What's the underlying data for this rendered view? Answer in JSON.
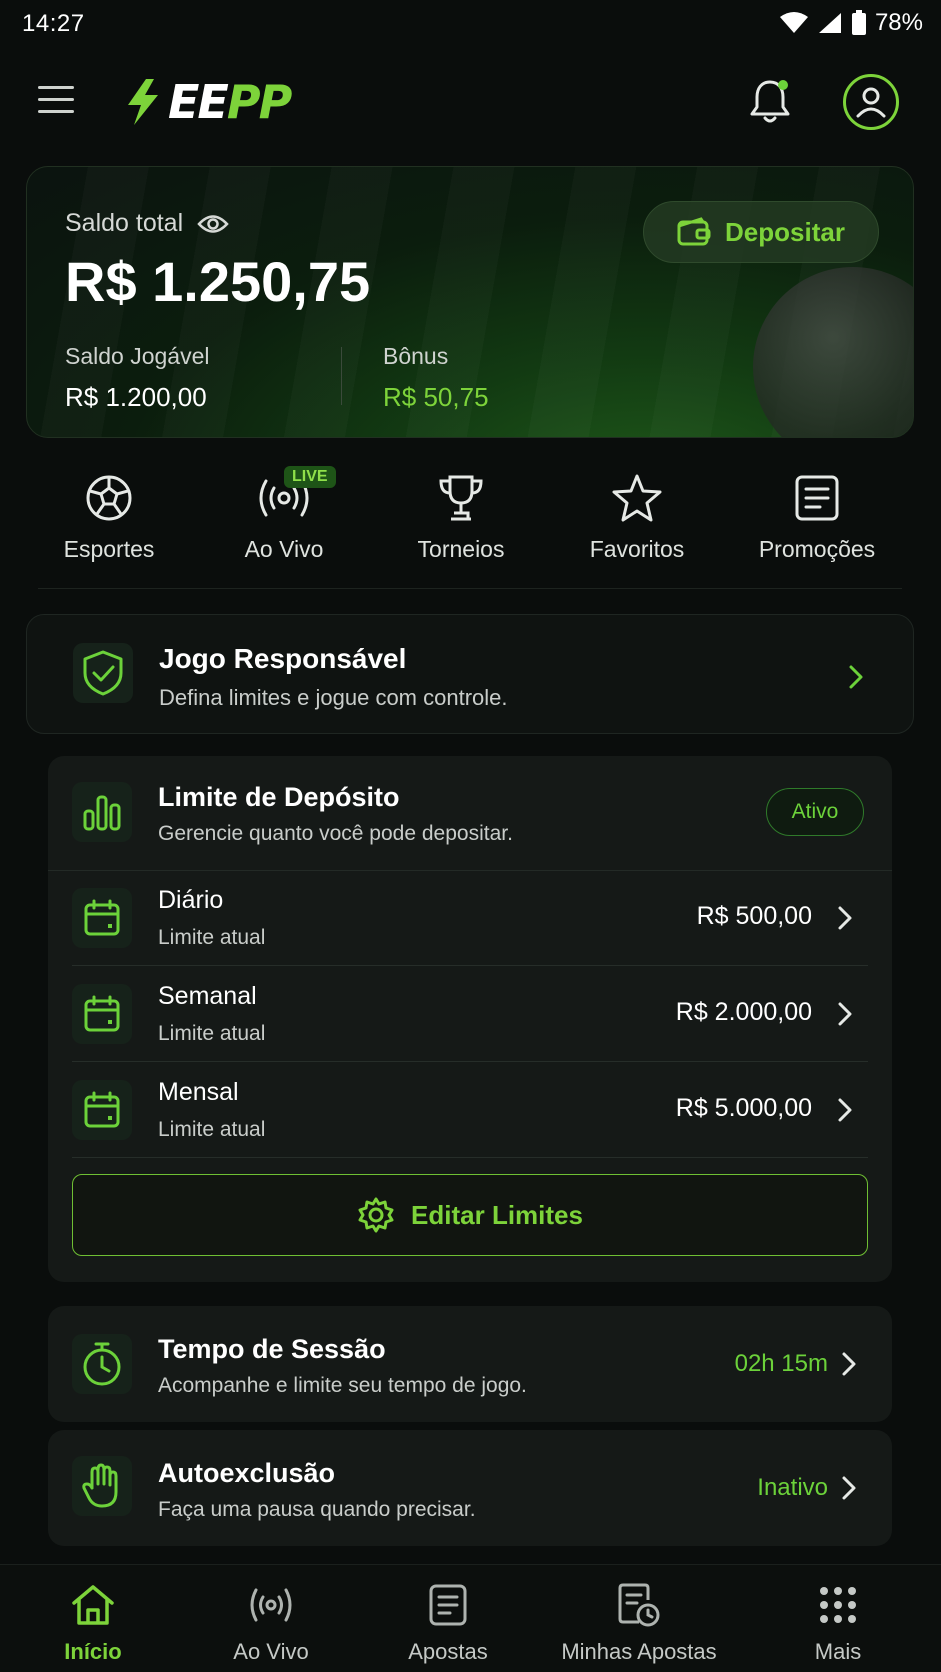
{
  "status_bar": {
    "time": "14:27",
    "battery": "78%"
  },
  "app": {
    "logo_main": "EE",
    "logo_accent": "PP"
  },
  "balance": {
    "label": "Saldo total",
    "total": "R$ 1.250,75",
    "deposit_label": "Depositar",
    "playable_label": "Saldo Jogável",
    "playable_value": "R$ 1.200,00",
    "bonus_label": "Bônus",
    "bonus_value": "R$ 50,75"
  },
  "quick_nav": {
    "live_badge": "LIVE",
    "items": [
      {
        "label": "Esportes",
        "icon": "soccer-ball-icon"
      },
      {
        "label": "Ao Vivo",
        "icon": "broadcast-icon"
      },
      {
        "label": "Torneios",
        "icon": "trophy-icon"
      },
      {
        "label": "Favoritos",
        "icon": "star-icon"
      },
      {
        "label": "Promoções",
        "icon": "document-icon"
      }
    ]
  },
  "responsible": {
    "title": "Jogo Responsável",
    "subtitle": "Defina limites e jogue com controle."
  },
  "deposit_limit": {
    "title": "Limite de Depósito",
    "subtitle": "Gerencie quanto você pode depositar.",
    "status": "Ativo",
    "rows": [
      {
        "name": "Diário",
        "desc": "Limite atual",
        "amount": "R$ 500,00"
      },
      {
        "name": "Semanal",
        "desc": "Limite atual",
        "amount": "R$ 2.000,00"
      },
      {
        "name": "Mensal",
        "desc": "Limite atual",
        "amount": "R$ 5.000,00"
      }
    ],
    "edit_label": "Editar Limites"
  },
  "session_time": {
    "title": "Tempo de Sessão",
    "subtitle": "Acompanhe e limite seu tempo de jogo.",
    "value": "02h 15m"
  },
  "self_exclusion": {
    "title": "Autoexclusão",
    "subtitle": "Faça uma pausa quando precisar.",
    "value": "Inativo"
  },
  "bottom_nav": {
    "items": [
      {
        "label": "Início",
        "icon": "home-icon"
      },
      {
        "label": "Ao Vivo",
        "icon": "broadcast-icon"
      },
      {
        "label": "Apostas",
        "icon": "bet-slip-icon"
      },
      {
        "label": "Minhas Apostas",
        "icon": "history-icon"
      },
      {
        "label": "Mais",
        "icon": "grid-dots-icon"
      }
    ]
  },
  "colors": {
    "accent": "#7dd33a",
    "background": "#0a0d0c",
    "card": "#151917"
  }
}
